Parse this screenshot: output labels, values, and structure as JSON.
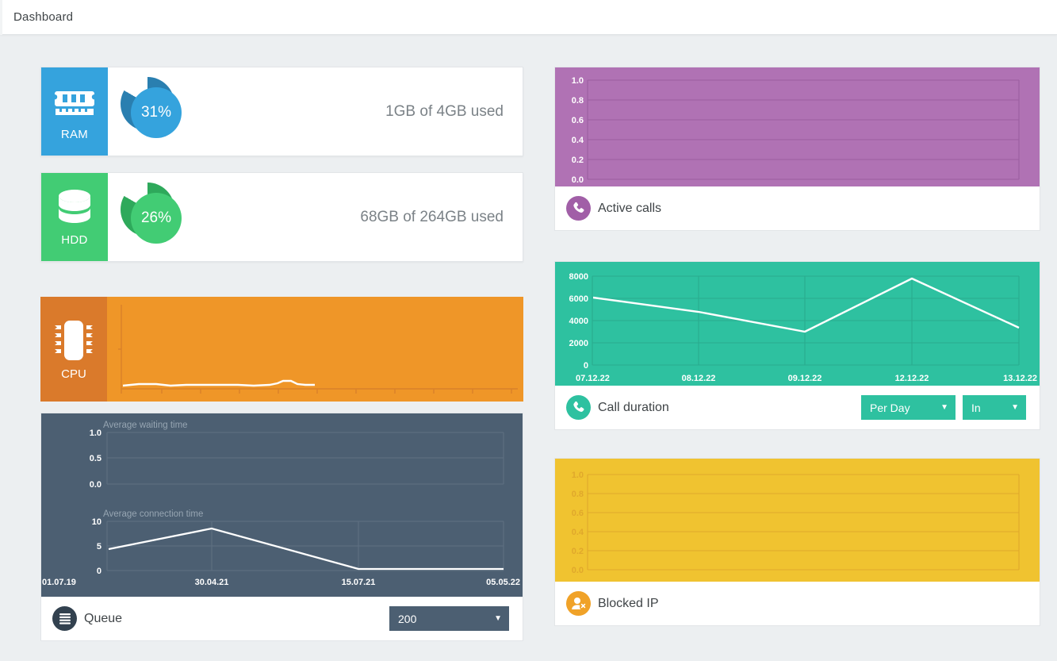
{
  "header": {
    "title": "Dashboard"
  },
  "resources": [
    {
      "key": "ram",
      "label": "RAM",
      "icon": "memory-module-icon",
      "percent": "31%",
      "percent_value": 31,
      "usage": "1GB of 4GB used",
      "color": "#35a3dd",
      "arc_color": "#2a7fb0"
    },
    {
      "key": "hdd",
      "label": "HDD",
      "icon": "database-icon",
      "percent": "26%",
      "percent_value": 26,
      "usage": "68GB of 264GB used",
      "color": "#42cc74",
      "arc_color": "#2ea95b"
    }
  ],
  "cpu": {
    "label": "CPU",
    "icon": "cpu-chip-icon",
    "color": "#ef9628",
    "badge_color": "#da7a2b"
  },
  "queue": {
    "name": "Queue",
    "icon": "queue-list-icon",
    "background": "#4c5f72",
    "dropdown": {
      "value": "200",
      "options": [
        "200"
      ]
    }
  },
  "active_calls": {
    "name": "Active calls",
    "icon": "phone-icon",
    "color": "#b072b4"
  },
  "call_duration": {
    "name": "Call duration",
    "icon": "phone-icon",
    "color": "#2ec1a0",
    "dropdown_period": {
      "value": "Per Day",
      "options": [
        "Per Day"
      ]
    },
    "dropdown_direction": {
      "value": "In",
      "options": [
        "In"
      ]
    }
  },
  "blocked_ip": {
    "name": "Blocked IP",
    "icon": "user-blocked-icon",
    "color": "#f0c330"
  },
  "chart_data": [
    {
      "id": "cpu-load",
      "type": "line",
      "title": "",
      "xlabel": "",
      "ylabel": "",
      "x": [
        0,
        1,
        2,
        3,
        4,
        5,
        6,
        7,
        8,
        9,
        10,
        11,
        12,
        13,
        14,
        15,
        16,
        17,
        18
      ],
      "values": [
        0.02,
        0.04,
        0.03,
        0.02,
        0.03,
        0.02,
        0.02,
        0.03,
        0.02,
        0.02,
        0.03,
        0.02,
        0.06,
        0.07,
        0.03,
        0.02,
        0.03,
        null,
        null
      ],
      "ylim": [
        0,
        1
      ],
      "grid": false,
      "tick_count": 12,
      "line_color": "#ffffff"
    },
    {
      "id": "average-waiting-time",
      "type": "line",
      "title": "Average waiting time",
      "xlabel": "",
      "ylabel": "",
      "categories": [
        "01.07.19",
        "30.04.21",
        "15.07.21",
        "05.05.22"
      ],
      "values": [],
      "yticks": [
        "0.0",
        "0.5",
        "1.0"
      ],
      "ylim": [
        0,
        1
      ],
      "grid": true,
      "line_color": "#ffffff"
    },
    {
      "id": "average-connection-time",
      "type": "line",
      "title": "Average connection time",
      "xlabel": "",
      "ylabel": "",
      "categories": [
        "01.07.19",
        "30.04.21",
        "15.07.21",
        "05.05.22"
      ],
      "values": [
        4.3,
        8.6,
        0.4,
        0.4
      ],
      "yticks": [
        "0",
        "5",
        "10"
      ],
      "ylim": [
        0,
        10
      ],
      "grid": true,
      "line_color": "#ffffff"
    },
    {
      "id": "active-calls",
      "type": "line",
      "title": "",
      "xlabel": "",
      "ylabel": "",
      "categories": [],
      "values": [],
      "yticks": [
        "0.0",
        "0.2",
        "0.4",
        "0.6",
        "0.8",
        "1.0"
      ],
      "ylim": [
        0,
        1
      ],
      "grid": true,
      "line_color": "#ffffff"
    },
    {
      "id": "call-duration",
      "type": "line",
      "title": "",
      "xlabel": "",
      "ylabel": "",
      "categories": [
        "07.12.22",
        "08.12.22",
        "09.12.22",
        "12.12.22",
        "13.12.22"
      ],
      "values": [
        6050,
        4800,
        3000,
        7800,
        3350
      ],
      "yticks": [
        "0",
        "2000",
        "4000",
        "6000",
        "8000"
      ],
      "ylim": [
        0,
        8600
      ],
      "grid": true,
      "line_color": "#ffffff"
    },
    {
      "id": "blocked-ip",
      "type": "line",
      "title": "",
      "xlabel": "",
      "ylabel": "",
      "categories": [],
      "values": [],
      "yticks": [
        "0.0",
        "0.2",
        "0.4",
        "0.6",
        "0.8",
        "1.0"
      ],
      "ylim": [
        0,
        1
      ],
      "grid": true,
      "line_color": "#ffffff"
    }
  ]
}
